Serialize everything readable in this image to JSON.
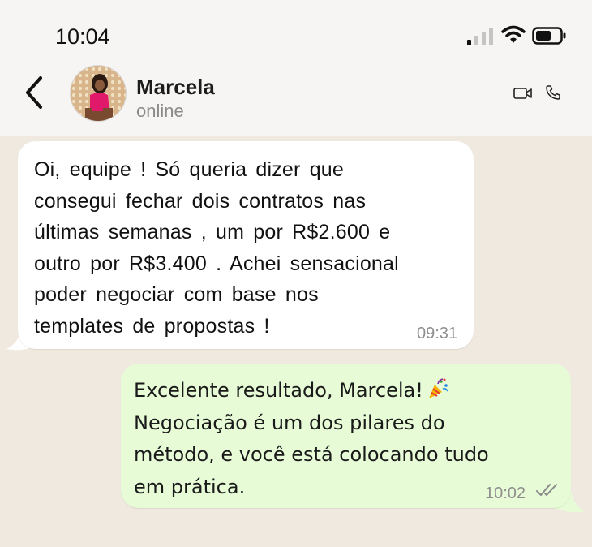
{
  "status_bar": {
    "time": "10:04",
    "icons": [
      "cellular-signal-icon",
      "wifi-icon",
      "battery-icon"
    ]
  },
  "header": {
    "back_icon": "chevron-left-icon",
    "contact_name": "Marcela",
    "contact_status": "online",
    "actions": [
      "video-call-icon",
      "phone-icon"
    ]
  },
  "messages": [
    {
      "direction": "incoming",
      "lines": [
        "Oi, equipe ! Só queria  dizer  que",
        "consegui  fechar  dois  contratos   nas",
        "últimas   semanas , um  por  R$2.600  e",
        "outro   por  R$3.400 . Achei  sensacional",
        "poder  negociar  com  base  nos",
        "templates    de  propostas  !"
      ],
      "time": "09:31"
    },
    {
      "direction": "outgoing",
      "lines": [
        "Excelente resultado, Marcela!",
        "Negociação é um dos pilares do",
        "método, e você está colocando tudo",
        "em prática."
      ],
      "emoji": "party-popper-icon",
      "time": "10:02",
      "read_receipt": "double-check-icon"
    }
  ],
  "colors": {
    "incoming_bubble": "#ffffff",
    "outgoing_bubble": "#e6fbd6",
    "chat_background": "#efe9df",
    "header_background": "#f6f5f3"
  }
}
